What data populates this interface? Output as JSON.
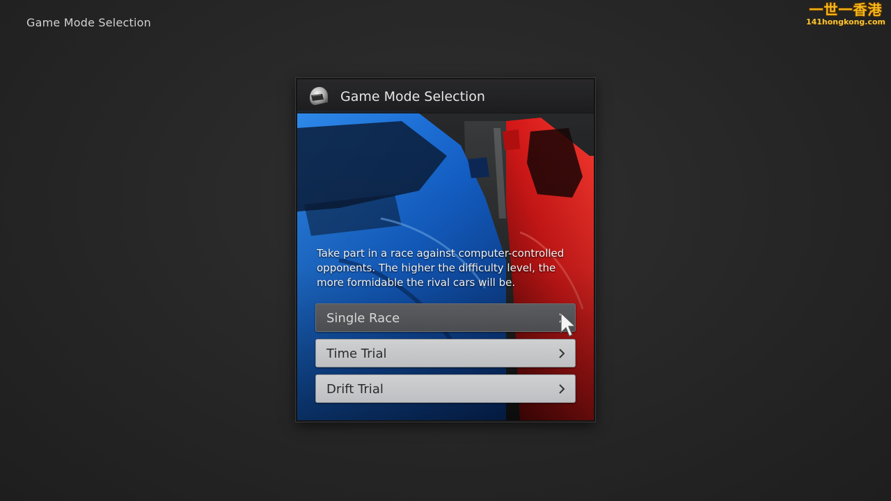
{
  "screen": {
    "title": "Game Mode Selection"
  },
  "watermark": {
    "line1": "一世一香港",
    "line2": "141hongkong.com"
  },
  "panel": {
    "title": "Game Mode Selection",
    "icon": "helmet-icon",
    "description": "Take part in a race against computer-controlled opponents. The higher the difficulty level, the more formidable the rival cars will be."
  },
  "menu": {
    "items": [
      {
        "label": "Single Race",
        "selected": true
      },
      {
        "label": "Time Trial",
        "selected": false
      },
      {
        "label": "Drift Trial",
        "selected": false
      }
    ]
  },
  "colors": {
    "background": "#262626",
    "button_idle": "#c6c7c9",
    "button_selected": "#525356",
    "blue_car": "#1e6fd9",
    "red_car": "#e01e1e",
    "watermark": "#f5b81c"
  }
}
